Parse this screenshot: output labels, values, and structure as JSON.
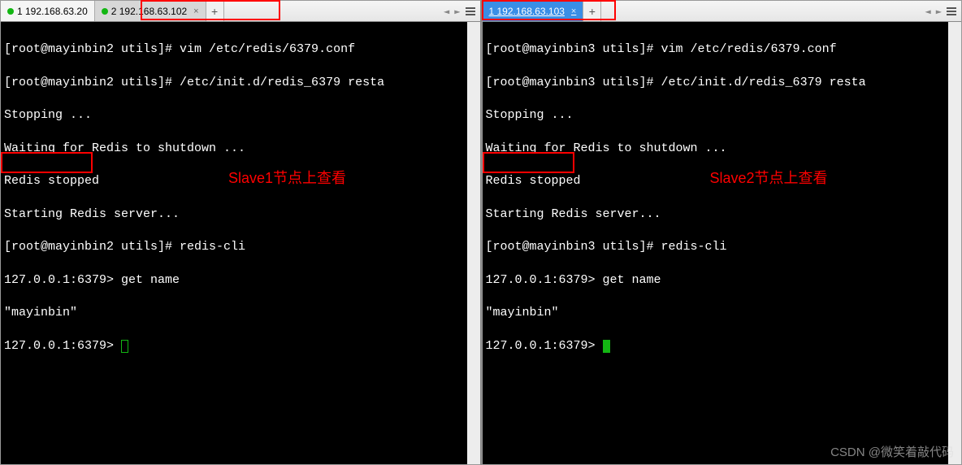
{
  "left": {
    "tabs": [
      {
        "label": "1 192.168.63.20",
        "dot": "green",
        "active": false
      },
      {
        "label": "2 192.168.63.102",
        "dot": "green",
        "active": true
      }
    ],
    "plus_label": "+",
    "nav": {
      "left_arrow": "◄",
      "right_arrow": "►"
    },
    "terminal": {
      "lines": [
        "[root@mayinbin2 utils]# vim /etc/redis/6379.conf",
        "[root@mayinbin2 utils]# /etc/init.d/redis_6379 resta",
        "Stopping ...",
        "Waiting for Redis to shutdown ...",
        "Redis stopped",
        "Starting Redis server...",
        "[root@mayinbin2 utils]# redis-cli",
        "127.0.0.1:6379> get name",
        "\"mayinbin\"",
        "127.0.0.1:6379> "
      ]
    },
    "annotation_text": "Slave1节点上查看"
  },
  "right": {
    "tabs": [
      {
        "label": "1 192.168.63.103",
        "active": true
      }
    ],
    "plus_label": "+",
    "nav": {
      "left_arrow": "◄",
      "right_arrow": "►"
    },
    "terminal": {
      "lines": [
        "[root@mayinbin3 utils]# vim /etc/redis/6379.conf",
        "[root@mayinbin3 utils]# /etc/init.d/redis_6379 resta",
        "Stopping ...",
        "Waiting for Redis to shutdown ...",
        "Redis stopped",
        "Starting Redis server...",
        "[root@mayinbin3 utils]# redis-cli",
        "127.0.0.1:6379> get name",
        "\"mayinbin\"",
        "127.0.0.1:6379> "
      ]
    },
    "annotation_text": "Slave2节点上查看"
  },
  "watermark": "CSDN @微笑着敲代码"
}
